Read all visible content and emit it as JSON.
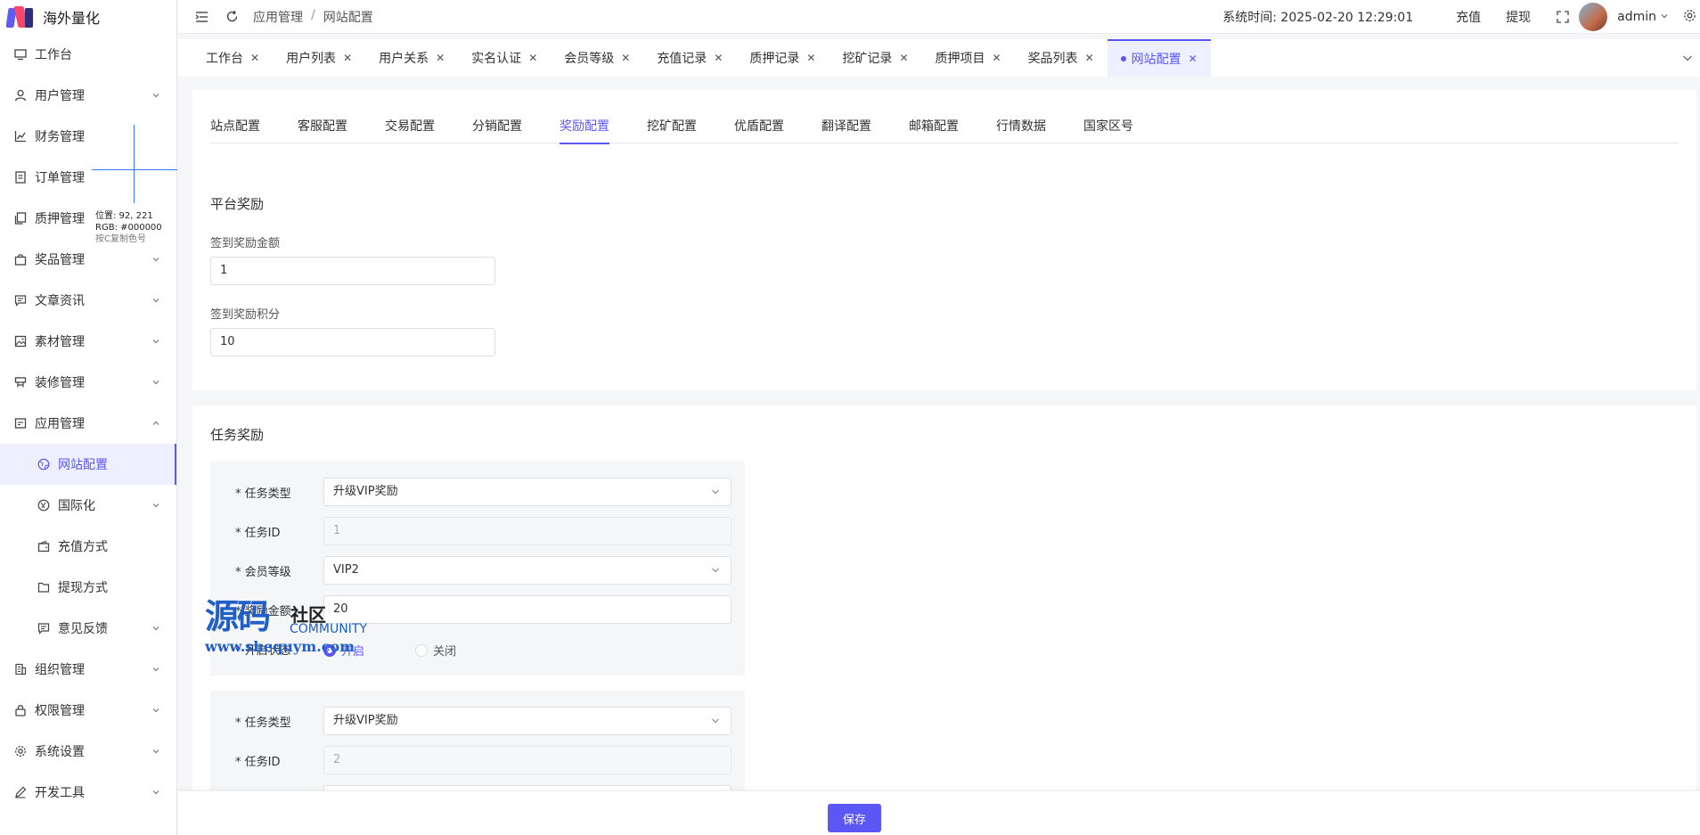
{
  "app": {
    "name": "海外量化"
  },
  "sidebar": {
    "items": [
      {
        "label": "工作台",
        "icon": "monitor-icon",
        "expandable": false
      },
      {
        "label": "用户管理",
        "icon": "user-icon",
        "expandable": true
      },
      {
        "label": "财务管理",
        "icon": "chart-icon",
        "expandable": false
      },
      {
        "label": "订单管理",
        "icon": "document-icon",
        "expandable": false
      },
      {
        "label": "质押管理",
        "icon": "copy-icon",
        "expandable": false
      },
      {
        "label": "奖品管理",
        "icon": "bag-icon",
        "expandable": true
      },
      {
        "label": "文章资讯",
        "icon": "message-icon",
        "expandable": true
      },
      {
        "label": "素材管理",
        "icon": "picture-icon",
        "expandable": true
      },
      {
        "label": "装修管理",
        "icon": "brush-icon",
        "expandable": true
      },
      {
        "label": "应用管理",
        "icon": "app-icon",
        "expandable": true,
        "expanded": true
      },
      {
        "label": "网站配置",
        "icon": "globe-icon",
        "sub": true,
        "active": true
      },
      {
        "label": "国际化",
        "icon": "translate-icon",
        "sub": true,
        "expandable": true
      },
      {
        "label": "充值方式",
        "icon": "wallet-icon",
        "sub": true
      },
      {
        "label": "提现方式",
        "icon": "folder-icon",
        "sub": true
      },
      {
        "label": "意见反馈",
        "icon": "feedback-icon",
        "sub": true,
        "expandable": true
      },
      {
        "label": "组织管理",
        "icon": "building-icon",
        "expandable": true
      },
      {
        "label": "权限管理",
        "icon": "lock-icon",
        "expandable": true
      },
      {
        "label": "系统设置",
        "icon": "gear-icon",
        "expandable": true
      },
      {
        "label": "开发工具",
        "icon": "pen-icon",
        "expandable": true
      }
    ]
  },
  "color_picker": {
    "position": "位置: 92, 221",
    "rgb": "RGB: #000000",
    "hint": "按C复制色号"
  },
  "header": {
    "breadcrumb": [
      "应用管理",
      "网站配置"
    ],
    "sys_time": "系统时间: 2025-02-20 12:29:01",
    "recharge": "充值",
    "withdraw": "提现",
    "username": "admin"
  },
  "tabs": [
    "工作台",
    "用户列表",
    "用户关系",
    "实名认证",
    "会员等级",
    "充值记录",
    "质押记录",
    "挖矿记录",
    "质押项目",
    "奖品列表",
    "网站配置"
  ],
  "active_tab": "网站配置",
  "subtabs": [
    "站点配置",
    "客服配置",
    "交易配置",
    "分销配置",
    "奖励配置",
    "挖矿配置",
    "优盾配置",
    "翻译配置",
    "邮箱配置",
    "行情数据",
    "国家区号"
  ],
  "active_subtab": "奖励配置",
  "platform_reward": {
    "title": "平台奖励",
    "signin_amount_label": "签到奖励金额",
    "signin_amount": "1",
    "signin_points_label": "签到奖励积分",
    "signin_points": "10"
  },
  "task_reward": {
    "title": "任务奖励",
    "task1": {
      "type_label": "* 任务类型",
      "type_value": "升级VIP奖励",
      "id_label": "* 任务ID",
      "id_value": "1",
      "level_label": "* 会员等级",
      "level_value": "VIP2",
      "amount_label": "* 奖励金额",
      "amount_value": "20",
      "status_label": "* 开启状态",
      "status_on": "开启",
      "status_off": "关闭"
    },
    "task2": {
      "type_label": "* 任务类型",
      "type_value": "升级VIP奖励",
      "id_label": "* 任务ID",
      "id_value": "2"
    }
  },
  "watermark": {
    "big": "源码",
    "small": "社区",
    "community": "COMMUNITY",
    "url": "www.shequym.com"
  },
  "footer": {
    "save": "保存"
  },
  "colors": {
    "accent": "#5a57f5",
    "active_bg": "#eeefff"
  }
}
